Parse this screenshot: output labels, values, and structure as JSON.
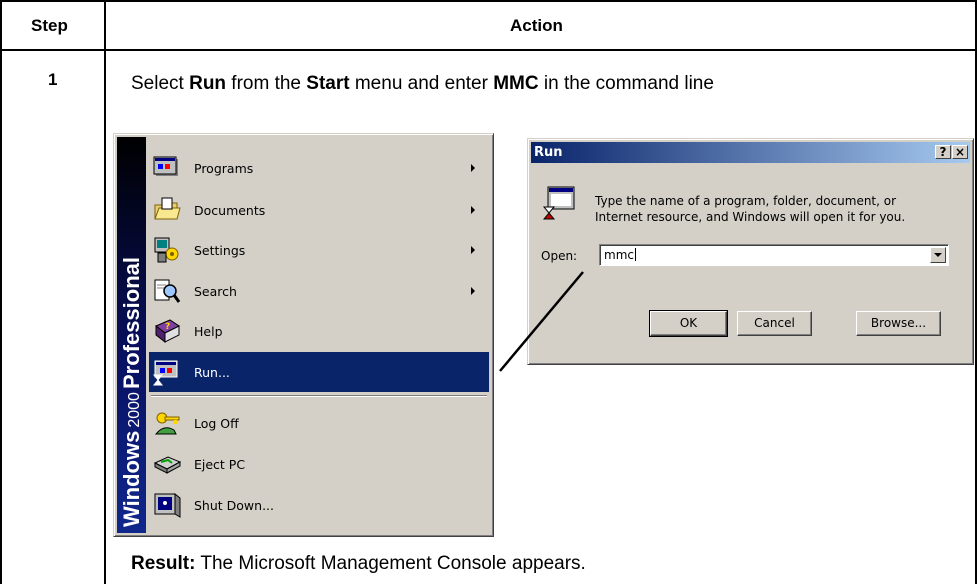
{
  "table": {
    "header_step": "Step",
    "header_action": "Action",
    "step_number": "1",
    "instruction": {
      "t1": "Select ",
      "b1": "Run",
      "t2": " from the ",
      "b2": "Start",
      "t3": " menu and enter ",
      "b3": "MMC",
      "t4": " in the command line"
    },
    "result": {
      "label": "Result:",
      "text": " The Microsoft Management Console appears."
    }
  },
  "start_menu": {
    "banner": {
      "word1": "Windows",
      "word2": "2000",
      "word3": "Professional"
    },
    "items": [
      {
        "label": "Programs",
        "icon": "programs-icon",
        "submenu": true
      },
      {
        "label": "Documents",
        "icon": "documents-icon",
        "submenu": true
      },
      {
        "label": "Settings",
        "icon": "settings-icon",
        "submenu": true
      },
      {
        "label": "Search",
        "icon": "search-icon",
        "submenu": true
      },
      {
        "label": "Help",
        "icon": "help-icon",
        "submenu": false
      },
      {
        "label": "Run...",
        "icon": "run-icon",
        "submenu": false,
        "selected": true
      },
      {
        "label": "Log Off",
        "icon": "log-off-icon",
        "submenu": false
      },
      {
        "label": "Eject PC",
        "icon": "eject-pc-icon",
        "submenu": false
      },
      {
        "label": "Shut Down...",
        "icon": "shut-down-icon",
        "submenu": false
      }
    ]
  },
  "run_dialog": {
    "title": "Run",
    "help_glyph": "?",
    "close_glyph": "×",
    "description_line1": "Type the name of a program, folder, document, or",
    "description_line2": "Internet resource, and Windows will open it for you.",
    "open_label": "Open:",
    "open_value": "mmc",
    "ok_label": "OK",
    "cancel_label": "Cancel",
    "browse_label": "Browse..."
  },
  "colors": {
    "selection": "#0a246a",
    "face": "#d4d0c8",
    "title_gradient_start": "#0a246a",
    "title_gradient_end": "#a6caf0"
  }
}
